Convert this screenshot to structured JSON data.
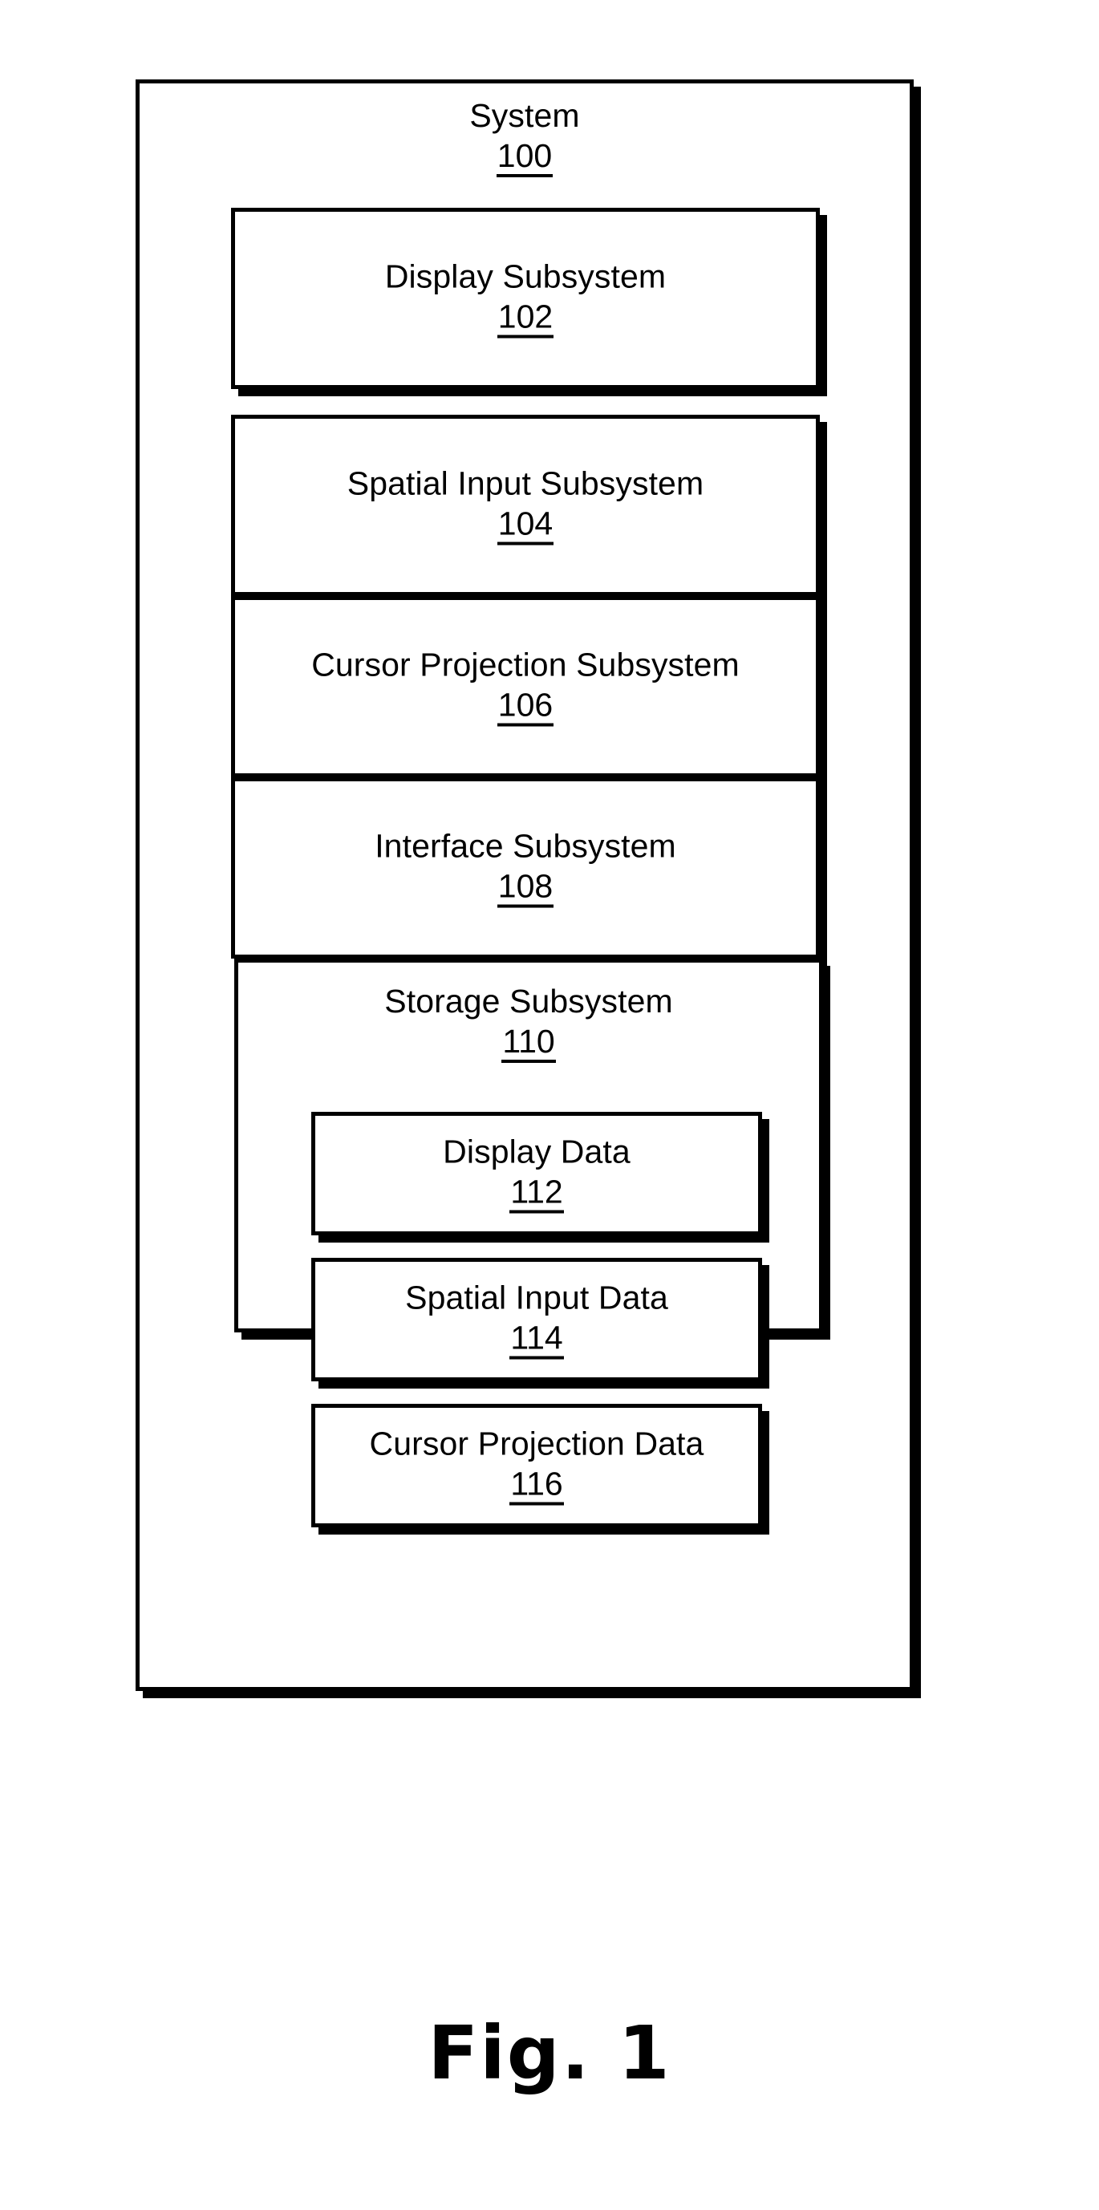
{
  "figure": {
    "caption": "Fig. 1",
    "system": {
      "title": "System",
      "ref": "100",
      "subsystems": [
        {
          "title": "Display Subsystem",
          "ref": "102"
        },
        {
          "title": "Spatial Input Subsystem",
          "ref": "104"
        },
        {
          "title": "Cursor Projection Subsystem",
          "ref": "106"
        },
        {
          "title": "Interface Subsystem",
          "ref": "108"
        }
      ],
      "storage": {
        "title": "Storage Subsystem",
        "ref": "110",
        "data_items": [
          {
            "title": "Display Data",
            "ref": "112"
          },
          {
            "title": "Spatial Input Data",
            "ref": "114"
          },
          {
            "title": "Cursor Projection Data",
            "ref": "116"
          }
        ]
      }
    }
  },
  "colors": {
    "stroke": "#000000",
    "fill": "#ffffff"
  }
}
